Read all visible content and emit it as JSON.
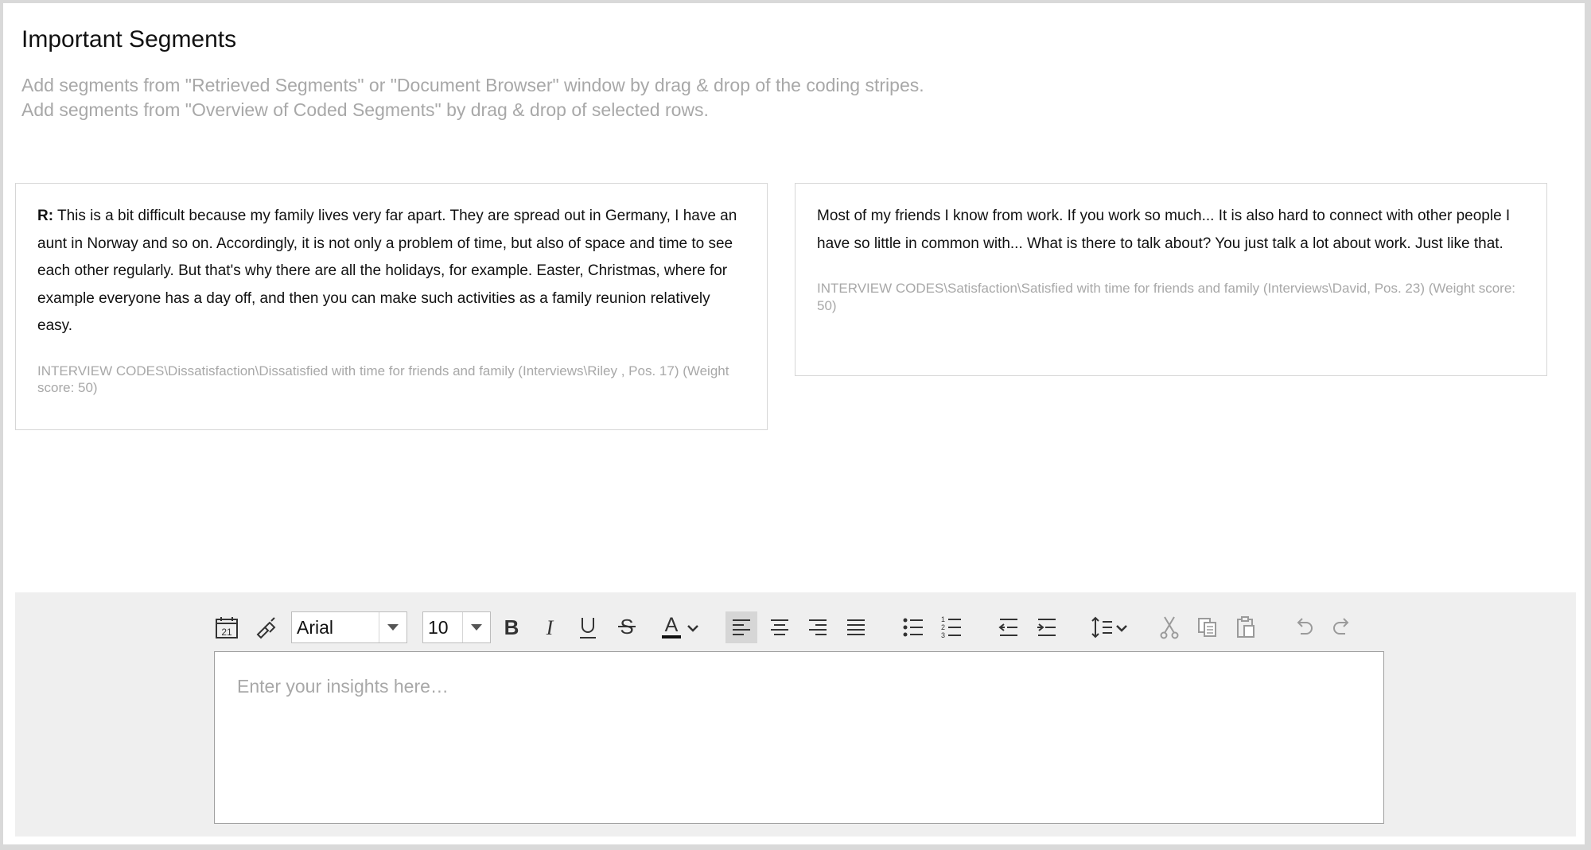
{
  "page": {
    "title": "Important Segments",
    "hint_lines": [
      "Add segments from \"Retrieved Segments\" or \"Document Browser\" window by drag & drop of the coding stripes.",
      "Add segments from \"Overview of Coded Segments\" by drag & drop of selected rows."
    ]
  },
  "segments": [
    {
      "speaker": "R:",
      "text": " This is a bit difficult because my family lives very far apart. They are spread out in Germany, I have an aunt in Norway and so on. Accordingly, it is not only a problem of time, but also of space and time to see each other regularly. But that's why there are all the holidays, for example. Easter, Christmas, where for example everyone has a day off, and then you can make such activities as a family reunion relatively easy.",
      "source": "INTERVIEW CODES\\Dissatisfaction\\Dissatisfied with time for friends and family (Interviews\\Riley , Pos. 17) (Weight score: 50)"
    },
    {
      "speaker": "",
      "text": "Most of my friends I know from work. If you work so much... It is also hard to connect with other people I have so little in common with... What is there to talk about? You just talk a lot about work. Just like that.",
      "source": "INTERVIEW CODES\\Satisfaction\\Satisfied with time for friends and family (Interviews\\David, Pos. 23) (Weight score: 50)"
    }
  ],
  "toolbar": {
    "date_icon_text": "21",
    "font_family": "Arial",
    "font_size": "10",
    "icons": [
      "insert-date-icon",
      "format-painter-icon",
      "bold-icon",
      "italic-icon",
      "underline-icon",
      "strikethrough-icon",
      "font-color-icon",
      "align-left-icon",
      "align-center-icon",
      "align-right-icon",
      "justify-icon",
      "bullet-list-icon",
      "numbered-list-icon",
      "outdent-icon",
      "indent-icon",
      "line-spacing-icon",
      "cut-icon",
      "copy-icon",
      "paste-icon",
      "undo-icon",
      "redo-icon"
    ],
    "font_color": "#111111",
    "active_button": "align-left"
  },
  "editor": {
    "placeholder": "Enter your insights here…"
  },
  "colors": {
    "hint_text": "#a8a8a8",
    "panel_bg": "#efefef",
    "active_button_bg": "#d6d6d6"
  }
}
